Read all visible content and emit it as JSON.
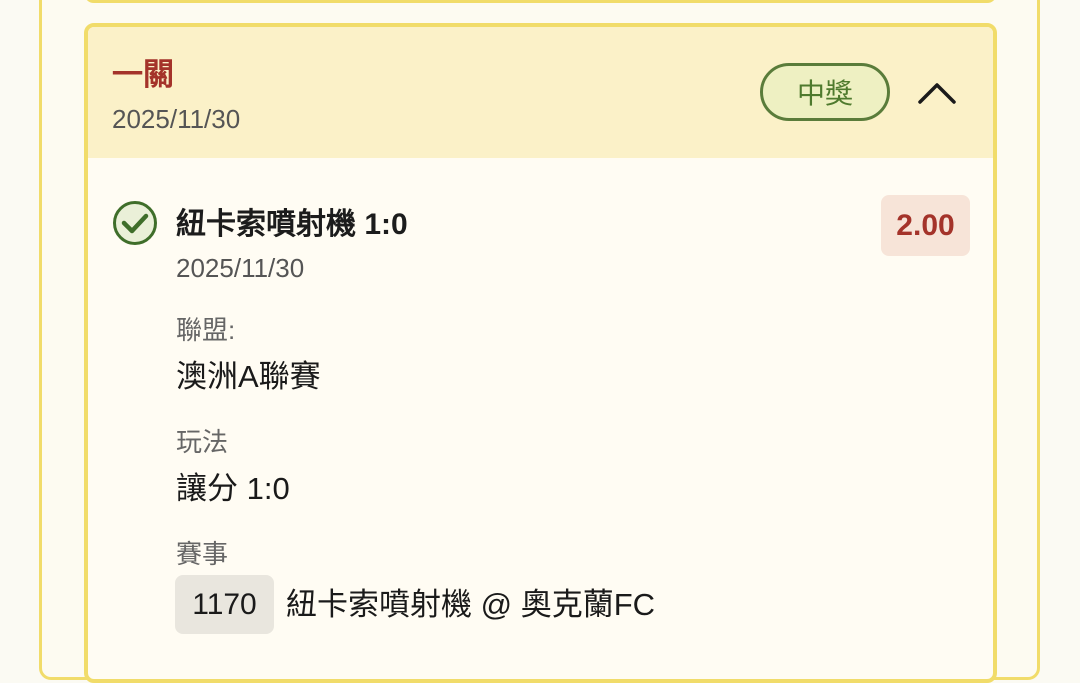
{
  "colors": {
    "accent_red": "#a4332a",
    "border_yellow": "#f1dc6a",
    "header_bg": "#fbf1c8",
    "win_green": "#4f7a2e"
  },
  "bet": {
    "type_label": "一關",
    "date": "2025/11/30",
    "status": "中獎",
    "collapse_icon": "chevron-up-icon"
  },
  "selection": {
    "status_icon": "check-circle-icon",
    "title": "紐卡索噴射機 1:0",
    "date": "2025/11/30",
    "odds": "2.00",
    "league_label": "聯盟:",
    "league_value": "澳洲A聯賽",
    "play_label": "玩法",
    "play_value": "讓分 1:0",
    "match_label": "賽事",
    "match_id": "1170",
    "match_name": "紐卡索噴射機 @ 奧克蘭FC"
  }
}
